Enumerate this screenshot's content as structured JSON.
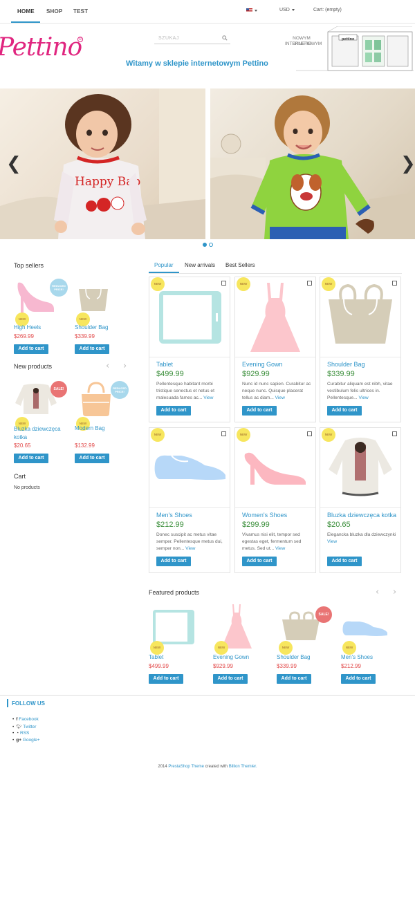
{
  "nav": {
    "items": [
      "HOME",
      "SHOP",
      "TEST"
    ],
    "currency": "USD",
    "cart": "Cart: (empty)"
  },
  "header": {
    "logo": "Pettino",
    "search_placeholder": "SZUKAJ",
    "welcome": "Witamy w sklepie internetowym Pettino",
    "sign": [
      "NOWYM SKLEPIE",
      "INTERNETOWYM"
    ],
    "sign_store": "pettino"
  },
  "slider": {
    "prev": "❮",
    "next": "❯"
  },
  "top_sellers": {
    "title": "Top sellers",
    "items": [
      {
        "name": "High Heels",
        "price": "$269.99",
        "badge": "NEW",
        "flag": "REDUCED PRICE!"
      },
      {
        "name": "Shoulder Bag",
        "price": "$339.99",
        "badge": "NEW"
      }
    ]
  },
  "new_products": {
    "title": "New products",
    "items": [
      {
        "name": "Bluzka dziewczęca kotka",
        "price": "$20.65",
        "badge": "NEW",
        "flag": "SALE!"
      },
      {
        "name": "Modern Bag",
        "price": "$132.99",
        "badge": "NEW",
        "flag": "REDUCED PRICE!"
      }
    ]
  },
  "cart_block": {
    "title": "Cart",
    "empty": "No products"
  },
  "common": {
    "add_to_cart": "Add to cart",
    "new": "NEW",
    "view": "View"
  },
  "tabs": [
    "Popular",
    "New arrivals",
    "Best Sellers"
  ],
  "products": [
    {
      "name": "Tablet",
      "price": "$499.99",
      "desc": "Pellentesque habitant morbi tristique senectus et netus et malesuada fames ac..."
    },
    {
      "name": "Evening Gown",
      "price": "$929.99",
      "desc": "Nunc id nunc sapien. Curabitur ac neque nunc. Quisque placerat tellus ac diam..."
    },
    {
      "name": "Shoulder Bag",
      "price": "$339.99",
      "desc": "Curabitur aliquam est nibh, vitae vestibulum felis ultrices in. Pellentesque..."
    },
    {
      "name": "Men's Shoes",
      "price": "$212.99",
      "desc": "Donec suscipit ac metus vitae semper. Pellentesque metus dui, semper non..."
    },
    {
      "name": "Women's Shoes",
      "price": "$299.99",
      "desc": "Vivamus nisi elit, tempor sed egestas eget, fermentum sed metus. Sed ut..."
    },
    {
      "name": "Bluzka dziewczęca kotka",
      "price": "$20.65",
      "desc": "Elegancka bluzka dla dziewczynki"
    }
  ],
  "featured": {
    "title": "Featured products",
    "items": [
      {
        "name": "Tablet",
        "price": "$499.99"
      },
      {
        "name": "Evening Gown",
        "price": "$929.99"
      },
      {
        "name": "Shoulder Bag",
        "price": "$339.99",
        "flag": "SALE!"
      },
      {
        "name": "Men's Shoes",
        "price": "$212.99"
      }
    ]
  },
  "footer": {
    "follow": "FOLLOW US",
    "social": [
      "Facebook",
      "Twitter",
      "RSS",
      "Google+"
    ],
    "copy_year": "2014",
    "copy_link1": "PrestaShop Theme",
    "copy_mid": "created with",
    "copy_link2": "Billion Themler."
  },
  "colors": {
    "accent": "#2f95c9",
    "brand": "#e0257f",
    "price_red": "#e24b4b",
    "price_green": "#3a8e3a",
    "badge_new": "#f7e65e"
  }
}
